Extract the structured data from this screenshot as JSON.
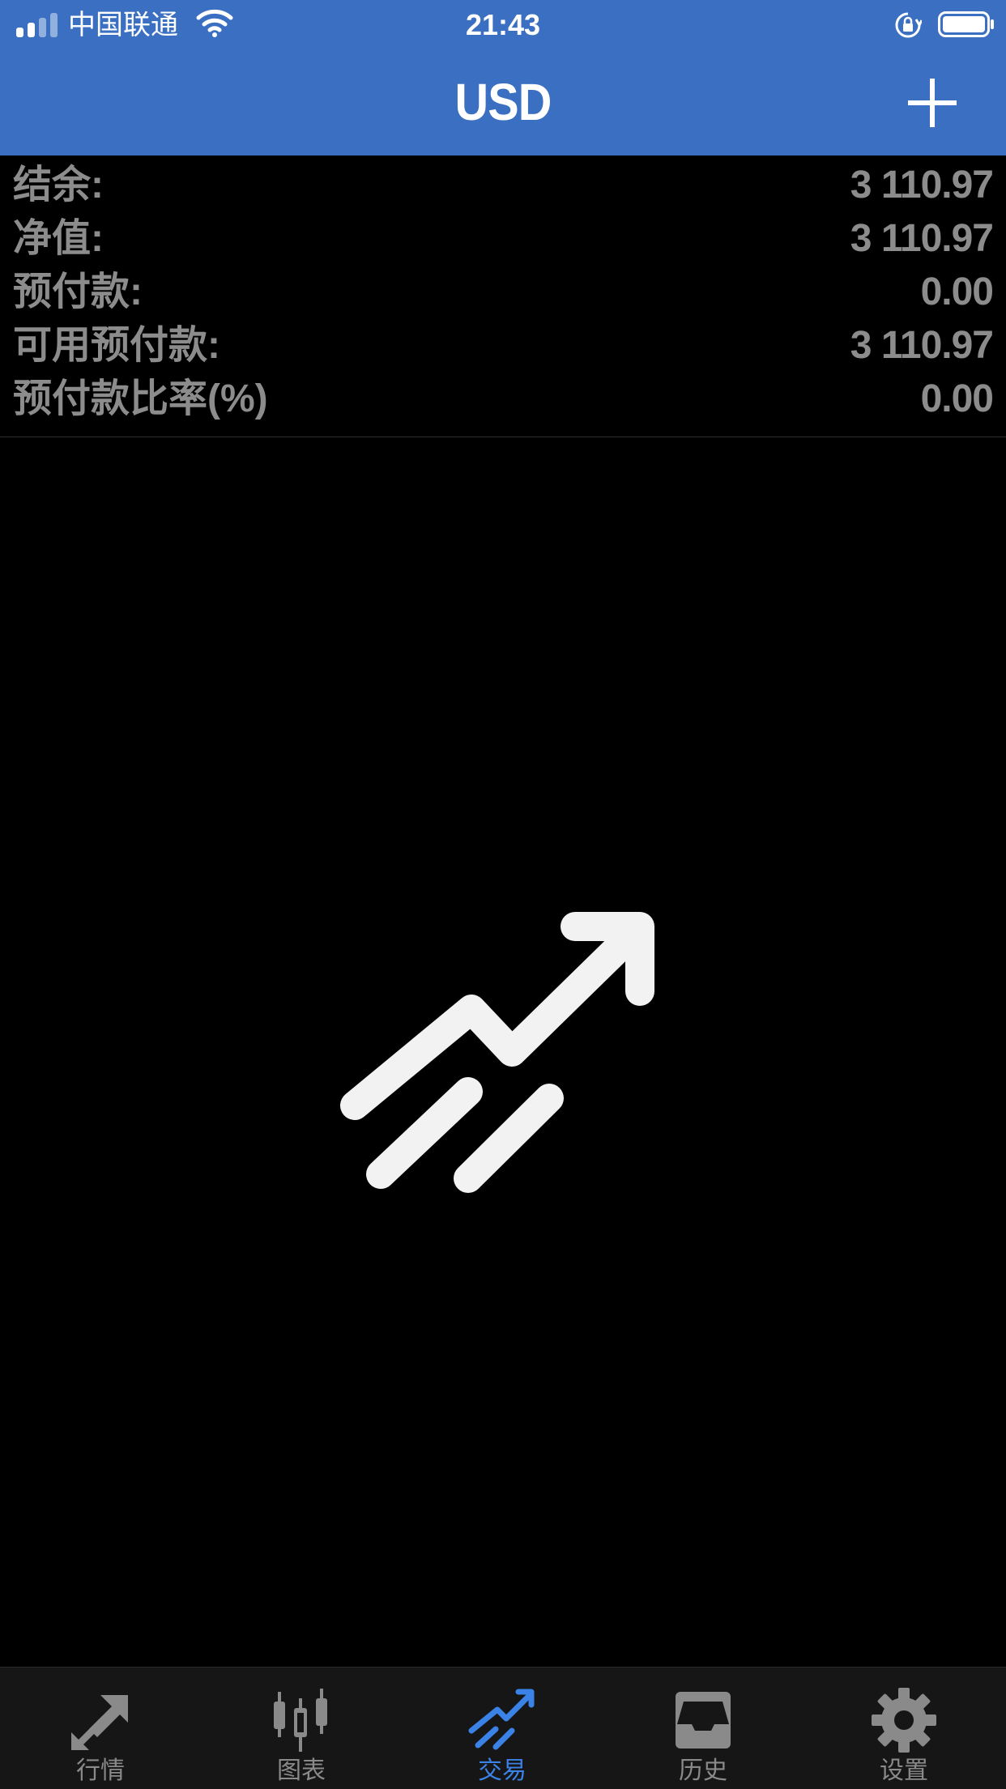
{
  "status_bar": {
    "carrier": "中国联通",
    "time": "21:43"
  },
  "nav": {
    "title": "USD",
    "add_icon": "plus-icon"
  },
  "summary": {
    "rows": [
      {
        "label": "结余:",
        "value": "3 110.97"
      },
      {
        "label": "净值:",
        "value": "3 110.97"
      },
      {
        "label": "预付款:",
        "value": "0.00"
      },
      {
        "label": "可用预付款:",
        "value": "3 110.97"
      },
      {
        "label": "预付款比率(%)",
        "value": "0.00"
      }
    ]
  },
  "empty_state": {
    "icon": "trade-trend-arrow-icon"
  },
  "tabs": [
    {
      "label": "行情",
      "icon": "quotes-arrows-icon",
      "active": false
    },
    {
      "label": "图表",
      "icon": "candlestick-chart-icon",
      "active": false
    },
    {
      "label": "交易",
      "icon": "trade-trend-icon",
      "active": true
    },
    {
      "label": "历史",
      "icon": "history-inbox-icon",
      "active": false
    },
    {
      "label": "设置",
      "icon": "gear-icon",
      "active": false
    }
  ],
  "colors": {
    "header_bg": "#3a6fc1",
    "active_tab": "#3b82e6",
    "inactive_tab": "#8a8a8a",
    "summary_text": "#8c8c8c",
    "background": "#000000"
  }
}
